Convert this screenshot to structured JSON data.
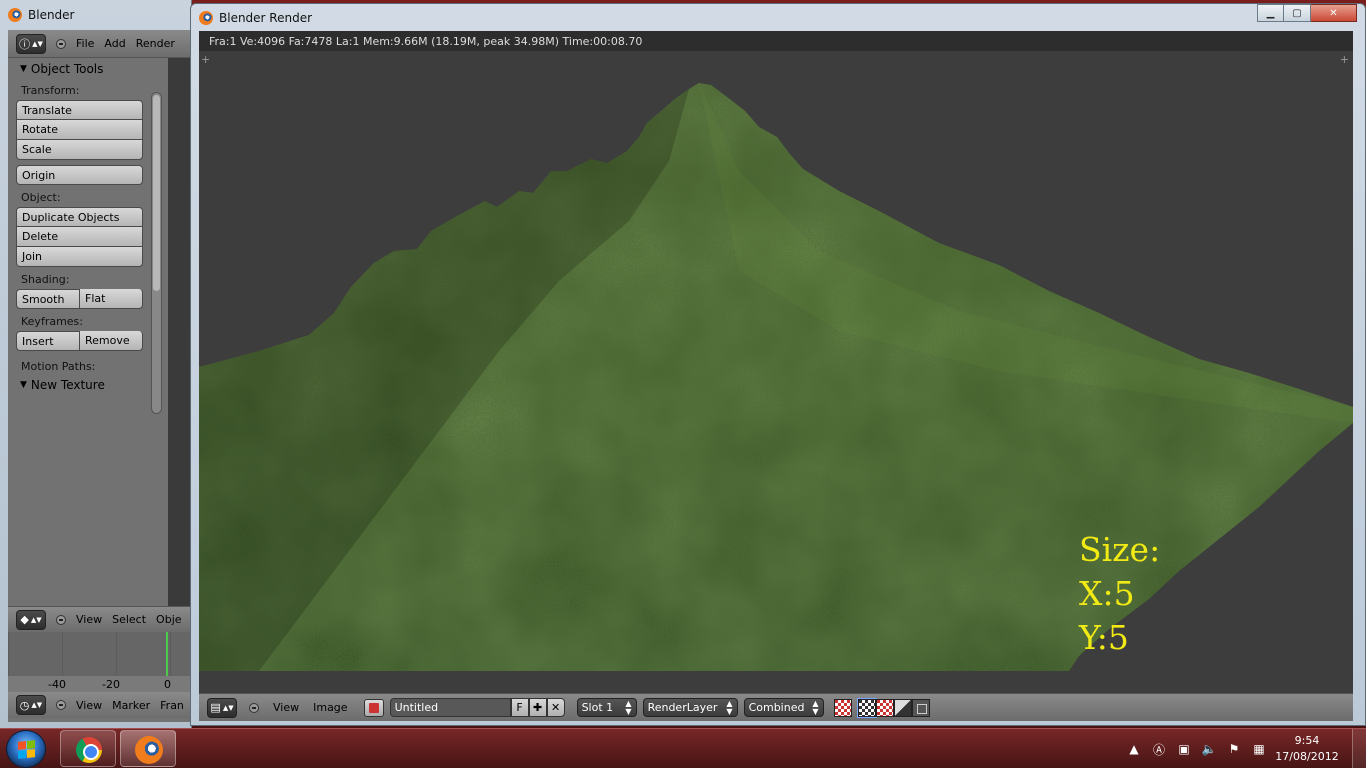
{
  "back_window": {
    "title": "Blender",
    "menu": [
      "File",
      "Add",
      "Render"
    ],
    "panel_title": "Object Tools",
    "groups": {
      "transform_label": "Transform:",
      "transform_buttons": [
        "Translate",
        "Rotate",
        "Scale"
      ],
      "origin_button": "Origin",
      "object_label": "Object:",
      "object_buttons": [
        "Duplicate Objects",
        "Delete",
        "Join"
      ],
      "shading_label": "Shading:",
      "shading_buttons": [
        "Smooth",
        "Flat"
      ],
      "keyframes_label": "Keyframes:",
      "keyframe_buttons": [
        "Insert",
        "Remove"
      ],
      "motion_paths_label": "Motion Paths:"
    },
    "new_texture_panel": "New Texture",
    "view3d_menu": [
      "View",
      "Select",
      "Obje"
    ],
    "timeline_ticks": [
      "-40",
      "-20",
      "0"
    ],
    "timeline_menu": [
      "View",
      "Marker",
      "Fran"
    ]
  },
  "render_window": {
    "title": "Blender Render",
    "info": "Fra:1  Ve:4096 Fa:7478 La:1 Mem:9.66M (18.19M, peak 34.98M) Time:00:08.70",
    "overlay_text": [
      "Size:",
      "X:5",
      "Y:5"
    ],
    "overlay_color": "#f2ea14",
    "footer": {
      "menu": [
        "View",
        "Image"
      ],
      "image_name": "Untitled",
      "fake_user": "F",
      "slot": "Slot 1",
      "render_layer": "RenderLayer",
      "pass": "Combined"
    }
  },
  "taskbar": {
    "apps": [
      "chrome-icon",
      "blender-icon"
    ],
    "time": "9:54",
    "date": "17/08/2012"
  }
}
